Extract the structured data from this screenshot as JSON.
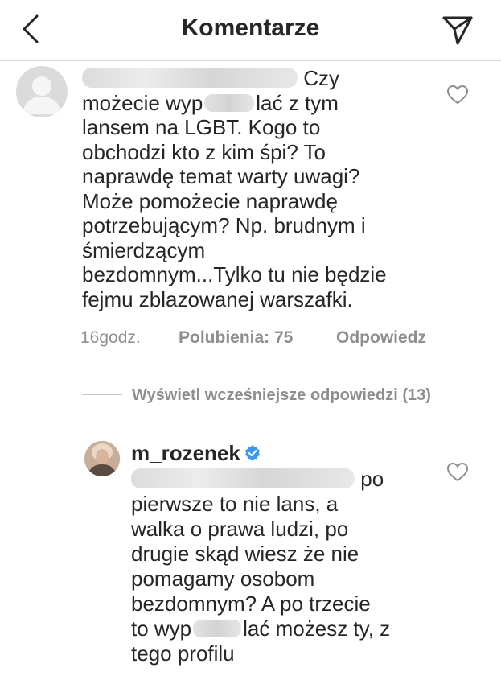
{
  "header": {
    "title": "Komentarze",
    "back_icon": "chevron-left-icon",
    "send_icon": "paper-plane-icon"
  },
  "comment1": {
    "lines": {
      "l1_end": "Czy",
      "l2_start": "możecie wyp",
      "l2_end": "lać z tym",
      "l3": "lansem na LGBT. Kogo to",
      "l4": "obchodzi kto z kim śpi? To",
      "l5": "naprawdę temat warty uwagi?",
      "l6": "Może pomożecie naprawdę",
      "l7": "potrzebującym? Np. brudnym i",
      "l8": "śmierdzącym",
      "l9": "bezdomnym...Tylko tu nie będzie",
      "l10": "fejmu zblazowanej warszafki."
    },
    "time": "16godz.",
    "likes": "Polubienia: 75",
    "reply": "Odpowiedz"
  },
  "view_replies": "Wyświetl wcześniejsze odpowiedzi (13)",
  "comment2": {
    "username": "m_rozenek",
    "lines": {
      "l1_end": "po",
      "l2": "pierwsze to nie lans, a",
      "l3": "walka o prawa ludzi, po",
      "l4": "drugie skąd wiesz że nie",
      "l5": "pomagamy osobom",
      "l6": "bezdomnym? A po trzecie",
      "l7_start": "to wyp",
      "l7_end": "lać możesz ty, z",
      "l8": "tego profilu"
    }
  },
  "colors": {
    "text": "#262626",
    "muted": "#8e8e8e",
    "border": "#dbdbdb",
    "verified": "#3897f0"
  }
}
